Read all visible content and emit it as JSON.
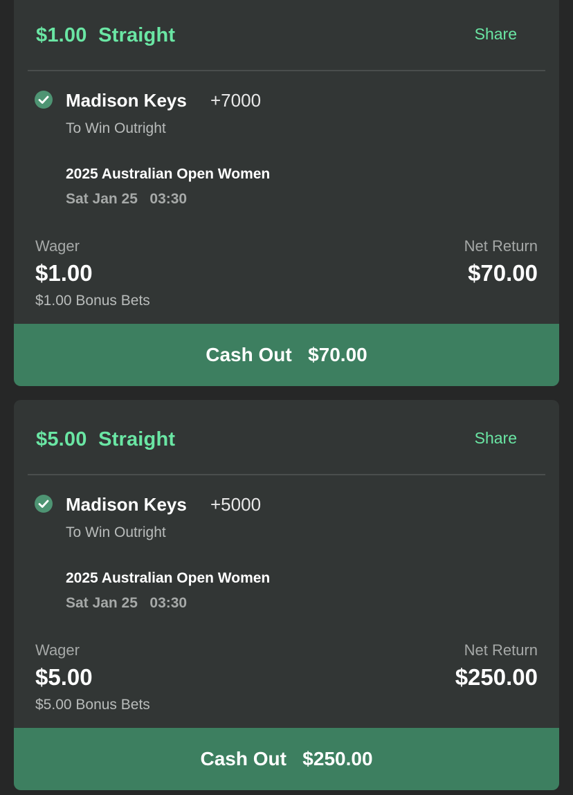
{
  "bets": [
    {
      "title": "$1.00  Straight",
      "share_label": "Share",
      "selection": "Madison Keys",
      "odds": "+7000",
      "market": "To Win Outright",
      "event": "2025 Australian Open Women",
      "event_time": "Sat Jan 25   03:30",
      "wager_label": "Wager",
      "wager": "$1.00",
      "bonus": "$1.00 Bonus Bets",
      "net_return_label": "Net Return",
      "net_return": "$70.00",
      "cashout_label": "Cash Out",
      "cashout_amount": "$70.00"
    },
    {
      "title": "$5.00  Straight",
      "share_label": "Share",
      "selection": "Madison Keys",
      "odds": "+5000",
      "market": "To Win Outright",
      "event": "2025 Australian Open Women",
      "event_time": "Sat Jan 25   03:30",
      "wager_label": "Wager",
      "wager": "$5.00",
      "bonus": "$5.00 Bonus Bets",
      "net_return_label": "Net Return",
      "net_return": "$250.00",
      "cashout_label": "Cash Out",
      "cashout_amount": "$250.00"
    }
  ],
  "colors": {
    "background": "#262727",
    "card": "#323635",
    "accent_green": "#6ae6a4",
    "cashout_button": "#3d7f60",
    "check_icon": "#4e9473"
  }
}
